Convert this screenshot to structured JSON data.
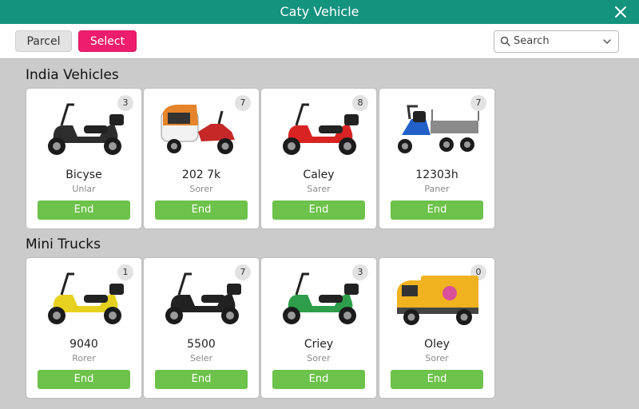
{
  "window": {
    "title": "Caty Vehicle"
  },
  "toolbar": {
    "parcel_label": "Parcel",
    "select_label": "Select",
    "search_placeholder": "Search"
  },
  "sections": [
    {
      "title": "India Vehicles",
      "cards": [
        {
          "name": "Bicyse",
          "sub": "Unlar",
          "badge": "3",
          "button": "End",
          "icon": "scooter-icon",
          "color": "#2d2d2d"
        },
        {
          "name": "202 7k",
          "sub": "Sorer",
          "badge": "7",
          "button": "End",
          "icon": "auto-rickshaw-icon",
          "color": "#e5842a"
        },
        {
          "name": "Caley",
          "sub": "Sarer",
          "badge": "8",
          "button": "End",
          "icon": "scooter-icon",
          "color": "#d92323"
        },
        {
          "name": "12303h",
          "sub": "Paner",
          "badge": "7",
          "button": "End",
          "icon": "cargo-trike-icon",
          "color": "#2060c8"
        }
      ]
    },
    {
      "title": "Mini Trucks",
      "cards": [
        {
          "name": "9040",
          "sub": "Rorer",
          "badge": "1",
          "button": "End",
          "icon": "scooter-icon",
          "color": "#e6d21e"
        },
        {
          "name": "5500",
          "sub": "Seler",
          "badge": "7",
          "button": "End",
          "icon": "scooter-icon",
          "color": "#222222"
        },
        {
          "name": "Criey",
          "sub": "Sorer",
          "badge": "3",
          "button": "End",
          "icon": "scooter-icon",
          "color": "#2e9e4a"
        },
        {
          "name": "Oley",
          "sub": "Sorer",
          "badge": "0",
          "button": "End",
          "icon": "mini-truck-icon",
          "color": "#f0b21e"
        }
      ]
    }
  ]
}
